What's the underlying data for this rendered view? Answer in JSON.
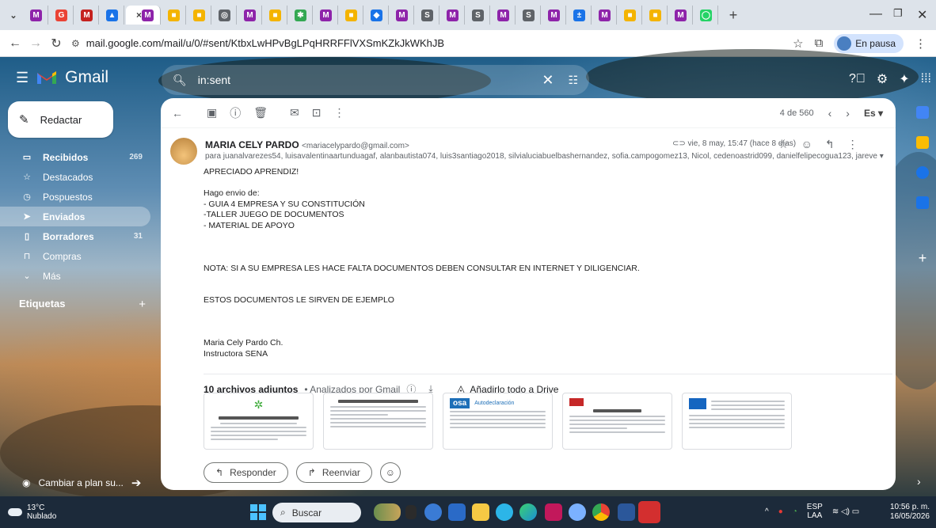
{
  "browser": {
    "url": "mail.google.com/mail/u/0/#sent/KtbxLwHPvBgLPqHRRFFlVXSmKZkJkWKhJB",
    "profile_label": "En pausa",
    "tabs": [
      {
        "label": "",
        "color": "#8e24aa",
        "glyph": "M"
      },
      {
        "label": "G",
        "color": "#ea4335",
        "glyph": "G"
      },
      {
        "label": "M",
        "color": "#c5221f",
        "glyph": "M"
      },
      {
        "label": "",
        "color": "#1a73e8",
        "glyph": "▲"
      },
      {
        "label": "",
        "color": "#8e24aa",
        "glyph": "M"
      },
      {
        "label": "",
        "color": "#f4b400",
        "glyph": "■"
      },
      {
        "label": "",
        "color": "#f4b400",
        "glyph": "■"
      },
      {
        "label": "",
        "color": "#5f6368",
        "glyph": "◎"
      },
      {
        "label": "",
        "color": "#8e24aa",
        "glyph": "M"
      },
      {
        "label": "",
        "color": "#f4b400",
        "glyph": "■"
      },
      {
        "label": "",
        "color": "#34a853",
        "glyph": "✱"
      },
      {
        "label": "",
        "color": "#8e24aa",
        "glyph": "M"
      },
      {
        "label": "",
        "color": "#f4b400",
        "glyph": "■"
      },
      {
        "label": "",
        "color": "#1a73e8",
        "glyph": "◆"
      },
      {
        "label": "",
        "color": "#8e24aa",
        "glyph": "M"
      },
      {
        "label": "",
        "color": "#5f6368",
        "glyph": "S"
      },
      {
        "label": "",
        "color": "#8e24aa",
        "glyph": "M"
      },
      {
        "label": "",
        "color": "#5f6368",
        "glyph": "S"
      },
      {
        "label": "",
        "color": "#8e24aa",
        "glyph": "M"
      },
      {
        "label": "",
        "color": "#5f6368",
        "glyph": "S"
      },
      {
        "label": "",
        "color": "#8e24aa",
        "glyph": "M"
      },
      {
        "label": "",
        "color": "#1a73e8",
        "glyph": "±"
      },
      {
        "label": "",
        "color": "#8e24aa",
        "glyph": "M"
      },
      {
        "label": "",
        "color": "#f4b400",
        "glyph": "■"
      },
      {
        "label": "",
        "color": "#f4b400",
        "glyph": "■"
      },
      {
        "label": "",
        "color": "#8e24aa",
        "glyph": "M"
      },
      {
        "label": "",
        "color": "#25d366",
        "glyph": "◯"
      }
    ]
  },
  "gmail": {
    "brand": "Gmail",
    "search_query": "in:sent",
    "compose_label": "Redactar",
    "nav": [
      {
        "label": "Recibidos",
        "count": "269",
        "icon": "inbox-icon",
        "bold": true,
        "active": false
      },
      {
        "label": "Destacados",
        "count": "",
        "icon": "star-icon",
        "bold": false,
        "active": false
      },
      {
        "label": "Pospuestos",
        "count": "",
        "icon": "clock-icon",
        "bold": false,
        "active": false
      },
      {
        "label": "Enviados",
        "count": "",
        "icon": "send-icon",
        "bold": false,
        "active": true
      },
      {
        "label": "Borradores",
        "count": "31",
        "icon": "draft-icon",
        "bold": true,
        "active": false
      },
      {
        "label": "Compras",
        "count": "",
        "icon": "shopping-icon",
        "bold": false,
        "active": false
      },
      {
        "label": "Más",
        "count": "",
        "icon": "chevron-down-icon",
        "bold": false,
        "active": false
      }
    ],
    "labels_heading": "Etiquetas",
    "upgrade_label": "Cambiar a plan su...",
    "pagination": "4 de 560",
    "input_tool": "Es"
  },
  "email": {
    "sender_name": "MARIA CELY PARDO",
    "sender_email": "<mariacelypardo@gmail.com>",
    "recipients": "para juanalvarezes54, luisavalentinaartunduagaf, alanbautista074, luis3santiago2018, silvialuciabuelbashernandez, sofia.campogomez13, Nicol, cedenoastrid099, danielfelipecogua123, jareve ▾",
    "date": "vie, 8 may, 15:47 (hace 8 días)",
    "body": {
      "l1": "APRECIADO APRENDIZ!",
      "l2": "Hago envio de:",
      "l3": "- GUIA 4   EMPRESA Y SU CONSTITUCIÓN",
      "l4": "-TALLER JUEGO DE DOCUMENTOS",
      "l5": "- MATERIAL DE APOYO",
      "l6": "NOTA: SI  A SU EMPRESA LES HACE FALTA DOCUMENTOS DEBEN CONSULTAR EN  INTERNET Y DILIGENCIAR.",
      "l7": "ESTOS DOCUMENTOS LE SIRVEN  DE EJEMPLO",
      "l8": "Maria Cely Pardo Ch.",
      "l9": "Instructora SENA"
    },
    "attachments_title": "10 archivos adjuntos",
    "attachments_scanned": "• Analizados por Gmail",
    "add_to_drive": "Añadirlo todo a Drive",
    "reply_label": "Responder",
    "forward_label": "Reenviar"
  },
  "taskbar": {
    "temp": "13°C",
    "weather": "Nublado",
    "search_label": "Buscar",
    "lang1": "ESP",
    "lang2": "LAA",
    "time": "10:56 p. m.",
    "date": "16/05/2026"
  }
}
